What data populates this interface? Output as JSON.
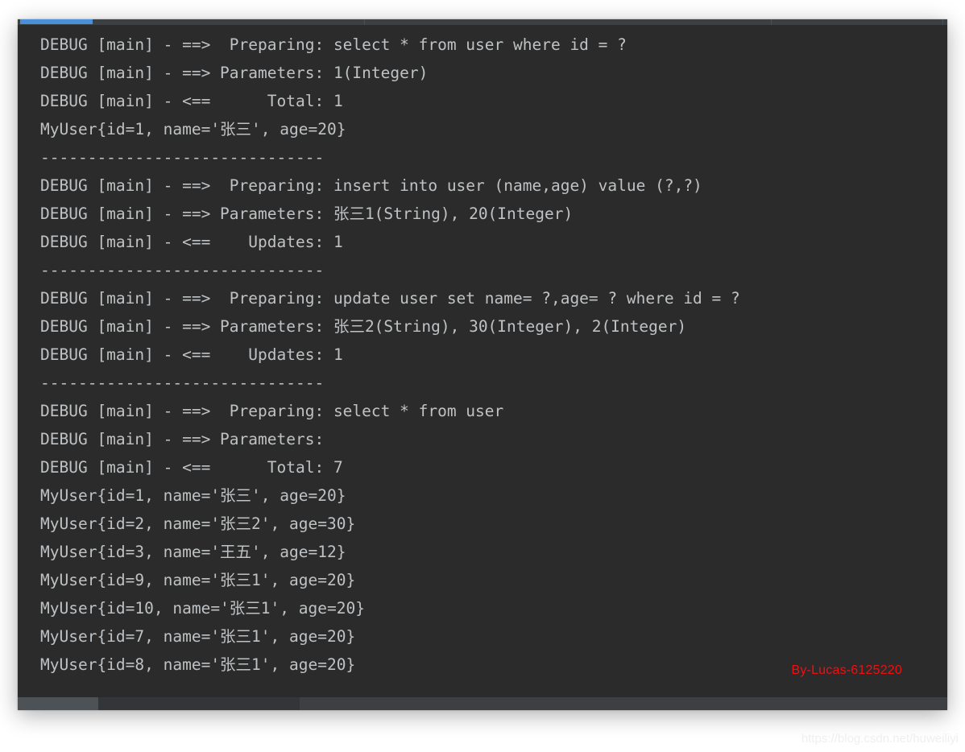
{
  "window": {
    "name": "console-log-output",
    "background_color": "#2b2b2b",
    "text_color": "#bfc2c4"
  },
  "top_strip": {
    "progress_color": "#4a90d9",
    "track_color": "#3c4043"
  },
  "scrollbar": {
    "thumb_color": "#4d5257",
    "track_color": "#3c4043"
  },
  "log": {
    "lines": [
      "DEBUG [main] - ==>  Preparing: select * from user where id = ?",
      "DEBUG [main] - ==> Parameters: 1(Integer)",
      "DEBUG [main] - <==      Total: 1",
      "MyUser{id=1, name='张三', age=20}",
      "------------------------------",
      "DEBUG [main] - ==>  Preparing: insert into user (name,age) value (?,?)",
      "DEBUG [main] - ==> Parameters: 张三1(String), 20(Integer)",
      "DEBUG [main] - <==    Updates: 1",
      "------------------------------",
      "DEBUG [main] - ==>  Preparing: update user set name= ?,age= ? where id = ?",
      "DEBUG [main] - ==> Parameters: 张三2(String), 30(Integer), 2(Integer)",
      "DEBUG [main] - <==    Updates: 1",
      "------------------------------",
      "DEBUG [main] - ==>  Preparing: select * from user",
      "DEBUG [main] - ==> Parameters: ",
      "DEBUG [main] - <==      Total: 7",
      "MyUser{id=1, name='张三', age=20}",
      "MyUser{id=2, name='张三2', age=30}",
      "MyUser{id=3, name='王五', age=12}",
      "MyUser{id=9, name='张三1', age=20}",
      "MyUser{id=10, name='张三1', age=20}",
      "MyUser{id=7, name='张三1', age=20}",
      "MyUser{id=8, name='张三1', age=20}",
      "------------------------------"
    ]
  },
  "watermarks": {
    "author": "By-Lucas-6125220",
    "author_color": "#ee1111",
    "site": "https://blog.csdn.net/huweiliyi",
    "site_color": "#efefef"
  }
}
